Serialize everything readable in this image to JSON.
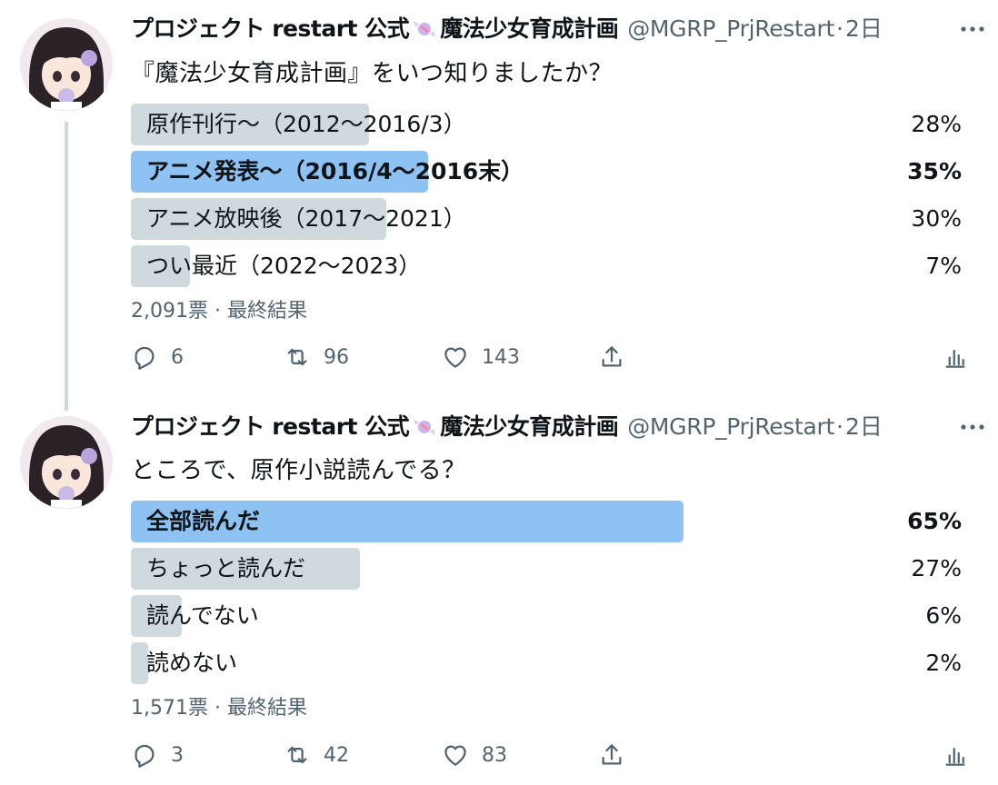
{
  "tweets": [
    {
      "author_name": "プロジェクト restart 公式",
      "author_name_suffix": "魔法少女育成計画",
      "handle": "@MGRP_PrjRestart",
      "separator": "·",
      "time": "2日",
      "question": "『魔法少女育成計画』をいつ知りましたか？",
      "options": [
        {
          "label": "原作刊行〜（2012〜2016/3）",
          "percent": "28%",
          "fraction": 0.28,
          "winner": false
        },
        {
          "label": "アニメ発表〜（2016/4〜2016末）",
          "percent": "35%",
          "fraction": 0.35,
          "winner": true
        },
        {
          "label": "アニメ放映後（2017〜2021）",
          "percent": "30%",
          "fraction": 0.3,
          "winner": false
        },
        {
          "label": "つい最近（2022〜2023）",
          "percent": "7%",
          "fraction": 0.07,
          "winner": false
        }
      ],
      "votes": "2,091票",
      "status": "· 最終結果",
      "replies": "6",
      "retweets": "96",
      "likes": "143"
    },
    {
      "author_name": "プロジェクト restart 公式",
      "author_name_suffix": "魔法少女育成計画",
      "handle": "@MGRP_PrjRestart",
      "separator": "·",
      "time": "2日",
      "question": "ところで、原作小説読んでる？",
      "options": [
        {
          "label": "全部読んだ",
          "percent": "65%",
          "fraction": 0.65,
          "winner": true
        },
        {
          "label": "ちょっと読んだ",
          "percent": "27%",
          "fraction": 0.27,
          "winner": false
        },
        {
          "label": "読んでない",
          "percent": "6%",
          "fraction": 0.06,
          "winner": false
        },
        {
          "label": "読めない",
          "percent": "2%",
          "fraction": 0.02,
          "winner": false
        }
      ],
      "votes": "1,571票",
      "status": "· 最終結果",
      "replies": "3",
      "retweets": "42",
      "likes": "83"
    }
  ],
  "colors": {
    "winner_bar": "#8ec2f3",
    "loser_bar": "#cfd9de",
    "secondary_text": "#536471",
    "thread_line": "#cfd9de"
  },
  "icons": {
    "reply": "reply-icon",
    "retweet": "retweet-icon",
    "like": "heart-icon",
    "share": "share-icon",
    "analytics": "analytics-icon",
    "more": "more-icon",
    "candy": "candy-icon"
  }
}
